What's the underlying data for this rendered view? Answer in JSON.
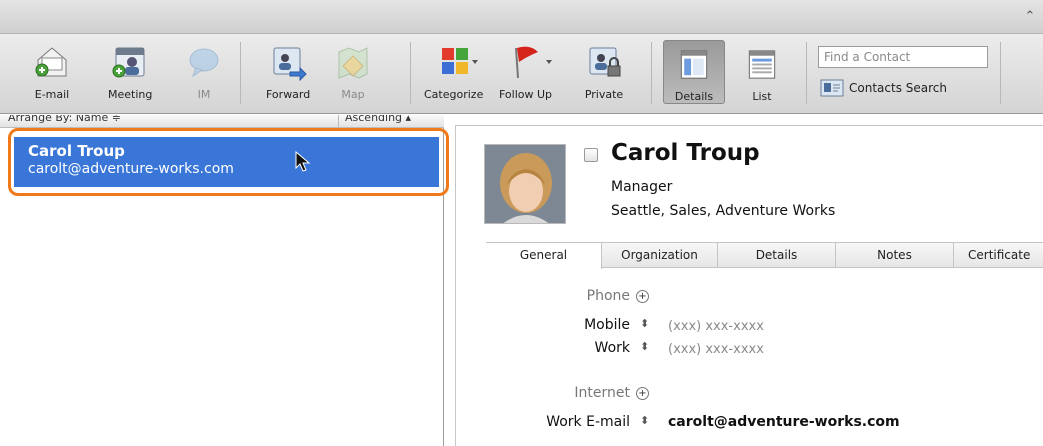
{
  "toolbar": {
    "email": "E-mail",
    "meeting": "Meeting",
    "im": "IM",
    "forward": "Forward",
    "map": "Map",
    "categorize": "Categorize",
    "follow_up": "Follow Up",
    "private": "Private",
    "details": "Details",
    "list": "List",
    "find_placeholder": "Find a Contact",
    "contacts_search": "Contacts Search"
  },
  "list_header": {
    "arrange": "Arrange By: Name ≑",
    "order": "Ascending ▴"
  },
  "contacts": [
    {
      "name": "Carol Troup",
      "email": "carolt@adventure-works.com"
    }
  ],
  "detail": {
    "name": "Carol Troup",
    "title": "Manager",
    "location": "Seattle,  Sales,  Adventure Works",
    "tabs": [
      "General",
      "Organization",
      "Details",
      "Notes",
      "Certificate"
    ],
    "phone_label": "Phone",
    "mobile_label": "Mobile",
    "mobile_value": "(xxx) xxx-xxxx",
    "work_label": "Work",
    "work_value": "(xxx) xxx-xxxx",
    "internet_label": "Internet",
    "work_email_label": "Work E-mail",
    "work_email_value": "carolt@adventure-works.com"
  },
  "colors": {
    "selection": "#3a76d8",
    "highlight": "#f07a1a"
  }
}
